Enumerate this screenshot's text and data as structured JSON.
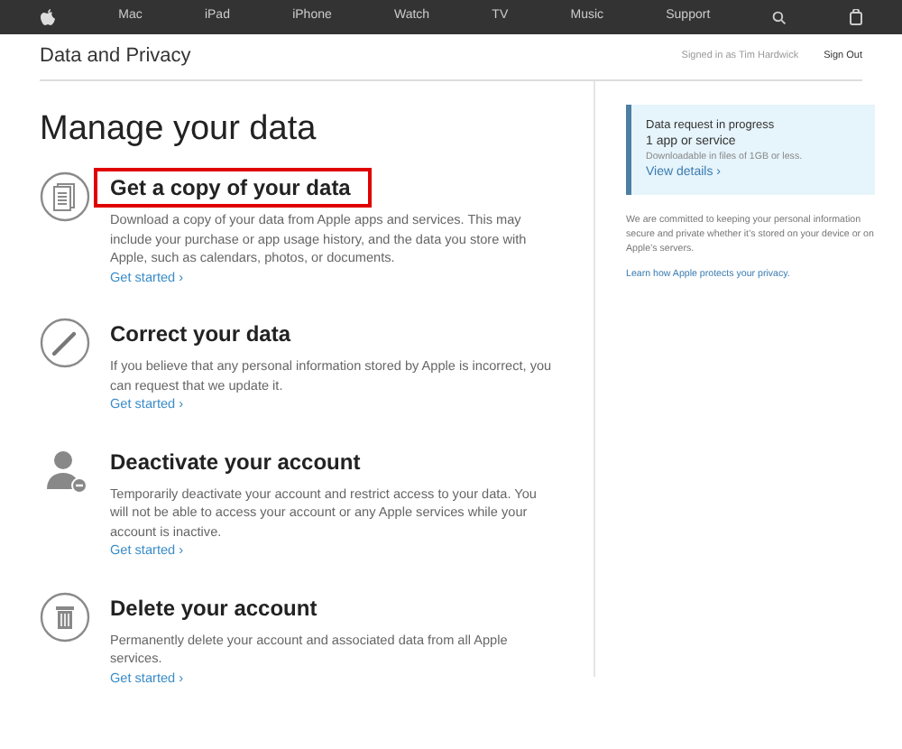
{
  "nav": {
    "items": [
      "Mac",
      "iPad",
      "iPhone",
      "Watch",
      "TV",
      "Music",
      "Support"
    ]
  },
  "header": {
    "title": "Data and Privacy",
    "signed_in": "Signed in as Tim Hardwick",
    "sign_out": "Sign Out"
  },
  "page_title": "Manage your data",
  "sections": [
    {
      "kind": "document",
      "title": "Get a copy of your data",
      "highlighted": true,
      "text": "Download a copy of your data from Apple apps and services. This may include your purchase or app usage history, and the data you store with Apple, such as calendars, photos, or documents.",
      "link": "Get started ›"
    },
    {
      "kind": "pencil",
      "title": "Correct your data",
      "highlighted": false,
      "text": "If you believe that any personal information stored by Apple is incorrect, you can request that we update it.",
      "link": "Get started ›"
    },
    {
      "kind": "person-minus",
      "title": "Deactivate your account",
      "highlighted": false,
      "text": "Temporarily deactivate your account and restrict access to your data. You will not be able to access your account or any Apple services while your account is inactive.",
      "link": "Get started ›"
    },
    {
      "kind": "trash",
      "title": "Delete your account",
      "highlighted": false,
      "text": "Permanently delete your account and associated data from all Apple services.",
      "link": "Get started ›"
    }
  ],
  "sidebar": {
    "status": {
      "title": "Data request in progress",
      "count": "1 app or service",
      "note": "Downloadable in files of 1GB or less.",
      "link": "View details ›"
    },
    "text": "We are committed to keeping your personal information secure and private whether it’s stored on your device or on Apple’s servers.",
    "link": "Learn how Apple protects your privacy."
  }
}
